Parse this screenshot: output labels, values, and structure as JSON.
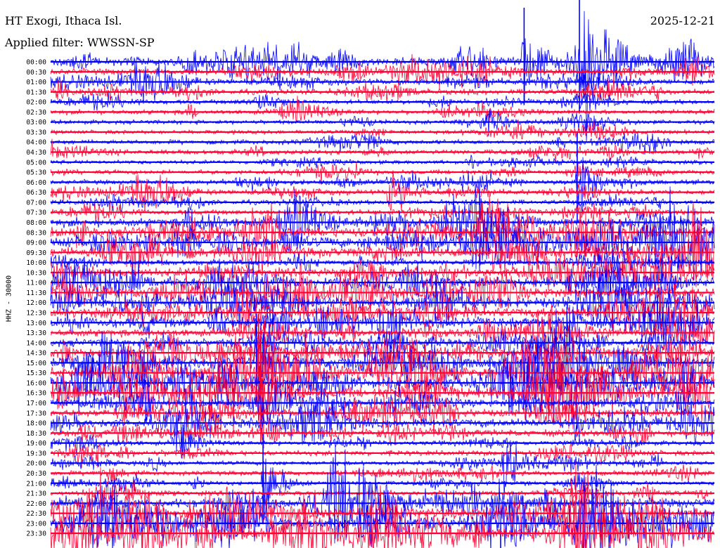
{
  "header": {
    "station": "HT Exogi, Ithaca Isl.",
    "date": "2025-12-21",
    "filter": "Applied filter: WWSSN-SP"
  },
  "channel": "HHZ - 30000",
  "colors": {
    "trace_a": "#0000ff",
    "trace_b": "#ff0033",
    "text": "#000000",
    "background": "#ffffff"
  },
  "chart_data": {
    "type": "line",
    "title": "HT Exogi, Ithaca Isl.",
    "ylabel": "HHZ - 30000",
    "x_range_minutes": [
      0,
      30
    ],
    "grid": false,
    "y_tick_labels": [
      "00:00",
      "00:30",
      "01:00",
      "01:30",
      "02:00",
      "02:30",
      "03:00",
      "03:30",
      "04:00",
      "04:30",
      "05:00",
      "05:30",
      "06:00",
      "06:30",
      "07:00",
      "07:30",
      "08:00",
      "08:30",
      "09:00",
      "09:30",
      "10:00",
      "10:30",
      "11:00",
      "11:30",
      "12:00",
      "12:30",
      "13:00",
      "13:30",
      "14:00",
      "14:30",
      "15:00",
      "15:30",
      "16:00",
      "16:30",
      "17:00",
      "17:30",
      "18:00",
      "18:30",
      "19:00",
      "19:30",
      "20:00",
      "20:30",
      "21:00",
      "21:30",
      "22:00",
      "22:30",
      "23:00",
      "23:30"
    ],
    "trace_colors": [
      "#0000ff",
      "#ff0033"
    ],
    "activity_level": [
      3.0,
      2.2,
      2.0,
      1.8,
      1.5,
      1.6,
      1.5,
      1.4,
      1.6,
      1.7,
      1.4,
      1.5,
      1.6,
      1.7,
      1.6,
      1.7,
      3.0,
      3.6,
      3.8,
      3.5,
      2.0,
      3.0,
      3.4,
      3.6,
      3.6,
      3.4,
      3.6,
      2.6,
      2.8,
      3.0,
      4.0,
      4.2,
      4.0,
      3.6,
      2.8,
      2.6,
      3.0,
      2.4,
      1.6,
      1.8,
      1.5,
      1.6,
      1.4,
      1.6,
      3.2,
      4.0,
      4.4,
      4.6
    ],
    "events": [
      {
        "row": 0,
        "minute": 21.4,
        "size": 5.5
      },
      {
        "row": 0,
        "minute": 23.9,
        "size": 7.0
      },
      {
        "row": 12,
        "minute": 23.8,
        "size": 5.0
      },
      {
        "row": 13,
        "minute": 15.3,
        "size": 3.5
      },
      {
        "row": 30,
        "minute": 9.3,
        "size": 5.0
      },
      {
        "row": 31,
        "minute": 9.4,
        "size": 6.0
      },
      {
        "row": 33,
        "minute": 9.5,
        "size": 7.0
      },
      {
        "row": 38,
        "minute": 5.6,
        "size": 3.0
      },
      {
        "row": 40,
        "minute": 20.5,
        "size": 4.0
      },
      {
        "row": 42,
        "minute": 9.6,
        "size": 5.0
      }
    ]
  }
}
